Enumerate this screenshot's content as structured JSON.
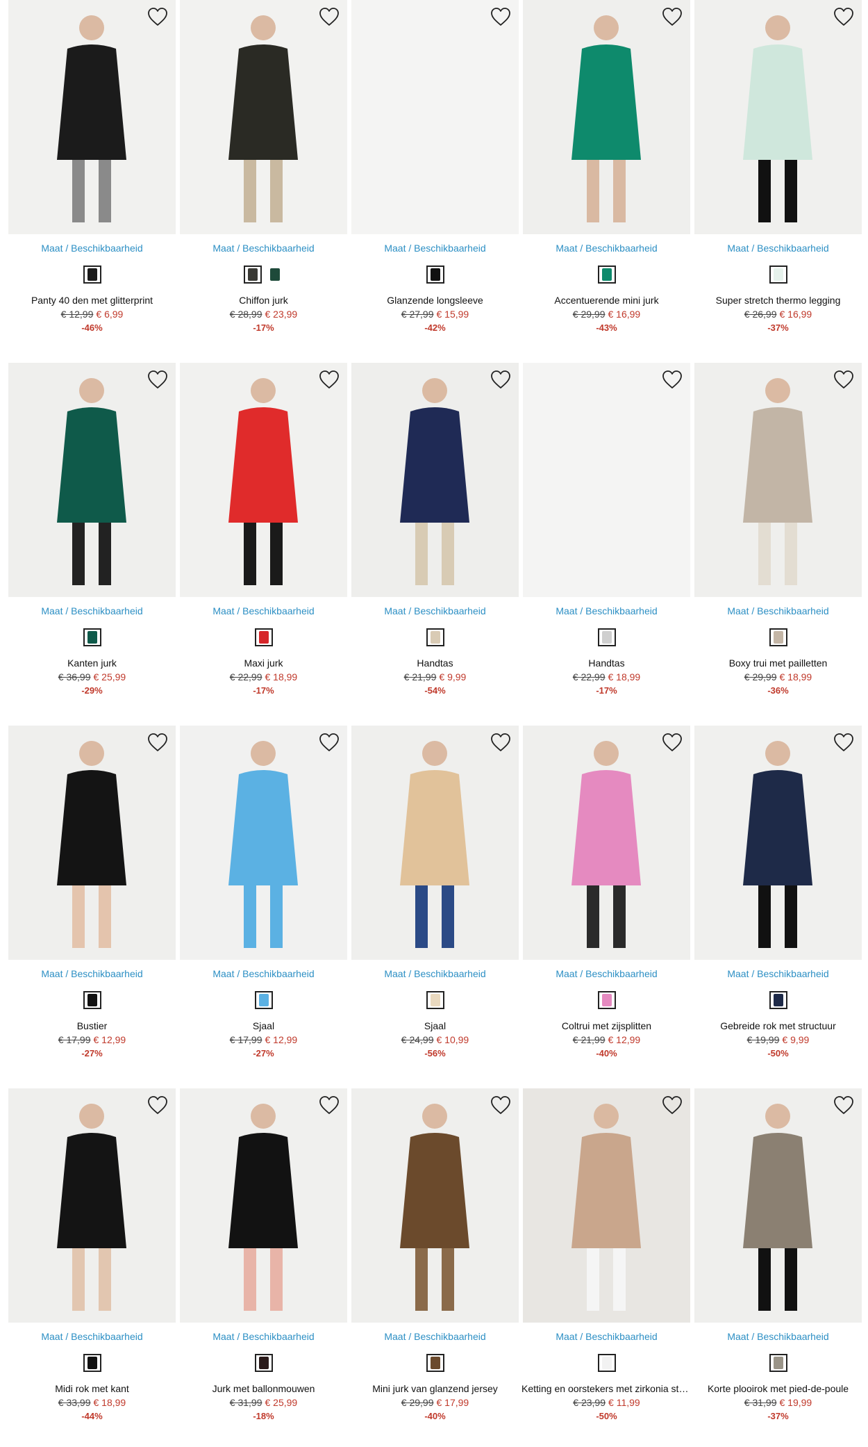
{
  "labels": {
    "size": "Maat / Beschikbaarheid"
  },
  "products": [
    {
      "name": "Panty 40 den met glitterprint",
      "old": "€ 12,99",
      "new": "€ 6,99",
      "disc": "-46%",
      "bg": "#f1f1ef",
      "fig": "#1b1b1b",
      "accent": "#8a8a8a",
      "swatches": [
        "#1a1a1a"
      ]
    },
    {
      "name": "Chiffon jurk",
      "old": "€ 28,99",
      "new": "€ 23,99",
      "disc": "-17%",
      "bg": "#f2f2f0",
      "fig": "#2a2a24",
      "accent": "#c9b9a0",
      "swatches": [
        "#3a3a35",
        "#1e4a3a"
      ]
    },
    {
      "name": "Glanzende longsleeve",
      "old": "€ 27,99",
      "new": "€ 15,99",
      "disc": "-42%",
      "bg": "#f4f4f3",
      "fig": "#f4f4f3",
      "accent": "#f4f4f3",
      "swatches": [
        "#111111"
      ]
    },
    {
      "name": "Accentuerende mini jurk",
      "old": "€ 29,99",
      "new": "€ 16,99",
      "disc": "-43%",
      "bg": "#efefed",
      "fig": "#0e8a6c",
      "accent": "#d9b9a2",
      "swatches": [
        "#0e8a6c"
      ]
    },
    {
      "name": "Super stretch thermo legging",
      "old": "€ 26,99",
      "new": "€ 16,99",
      "disc": "-37%",
      "bg": "#f0f0ee",
      "fig": "#cfe7dc",
      "accent": "#111111",
      "swatches": [
        "#e6f2ec"
      ]
    },
    {
      "name": "Kanten jurk",
      "old": "€ 36,99",
      "new": "€ 25,99",
      "disc": "-29%",
      "bg": "#efefed",
      "fig": "#0f5a4a",
      "accent": "#222222",
      "swatches": [
        "#0f5a4a"
      ]
    },
    {
      "name": "Maxi jurk",
      "old": "€ 22,99",
      "new": "€ 18,99",
      "disc": "-17%",
      "bg": "#f1f1ef",
      "fig": "#e02b2b",
      "accent": "#1a1a1a",
      "swatches": [
        "#d6262a"
      ]
    },
    {
      "name": "Handtas",
      "old": "€ 21,99",
      "new": "€ 9,99",
      "disc": "-54%",
      "bg": "#eeeeec",
      "fig": "#1f2a55",
      "accent": "#d8cbb4",
      "swatches": [
        "#d9cbb5"
      ]
    },
    {
      "name": "Handtas",
      "old": "€ 22,99",
      "new": "€ 18,99",
      "disc": "-17%",
      "bg": "#f4f4f3",
      "fig": "#f4f4f3",
      "accent": "#f4f4f3",
      "swatches": [
        "#cfcfcf"
      ]
    },
    {
      "name": "Boxy trui met pailletten",
      "old": "€ 29,99",
      "new": "€ 18,99",
      "disc": "-36%",
      "bg": "#efefed",
      "fig": "#c2b5a6",
      "accent": "#e3ddd2",
      "swatches": [
        "#c4b6a6"
      ]
    },
    {
      "name": "Bustier",
      "old": "€ 17,99",
      "new": "€ 12,99",
      "disc": "-27%",
      "bg": "#efefed",
      "fig": "#141414",
      "accent": "#e4c4ad",
      "swatches": [
        "#111111"
      ]
    },
    {
      "name": "Sjaal",
      "old": "€ 17,99",
      "new": "€ 12,99",
      "disc": "-27%",
      "bg": "#f1f1f0",
      "fig": "#5bb1e3",
      "accent": "#5bb1e3",
      "swatches": [
        "#5bb1e3"
      ]
    },
    {
      "name": "Sjaal",
      "old": "€ 24,99",
      "new": "€ 10,99",
      "disc": "-56%",
      "bg": "#efefed",
      "fig": "#e1c29a",
      "accent": "#2b4a86",
      "swatches": [
        "#e9d9bf"
      ]
    },
    {
      "name": "Coltrui met zijsplitten",
      "old": "€ 21,99",
      "new": "€ 12,99",
      "disc": "-40%",
      "bg": "#efefed",
      "fig": "#e58ac0",
      "accent": "#2a2a2a",
      "swatches": [
        "#e58ac0"
      ]
    },
    {
      "name": "Gebreide rok met structuur",
      "old": "€ 19,99",
      "new": "€ 9,99",
      "disc": "-50%",
      "bg": "#f0f0ee",
      "fig": "#1e2a48",
      "accent": "#111111",
      "swatches": [
        "#1e2a48"
      ]
    },
    {
      "name": "Midi rok met kant",
      "old": "€ 33,99",
      "new": "€ 18,99",
      "disc": "-44%",
      "bg": "#efefed",
      "fig": "#141414",
      "accent": "#e2c6b0",
      "swatches": [
        "#111111"
      ]
    },
    {
      "name": "Jurk met ballonmouwen",
      "old": "€ 31,99",
      "new": "€ 25,99",
      "disc": "-18%",
      "bg": "#f0f0ee",
      "fig": "#121212",
      "accent": "#e8b4a8",
      "swatches": [
        "#2a1a1a"
      ]
    },
    {
      "name": "Mini jurk van glanzend jersey",
      "old": "€ 29,99",
      "new": "€ 17,99",
      "disc": "-40%",
      "bg": "#efefed",
      "fig": "#6b4a2c",
      "accent": "#8a6a4a",
      "swatches": [
        "#6b4a2c"
      ]
    },
    {
      "name": "Ketting en oorstekers met zirkonia steentjes",
      "old": "€ 23,99",
      "new": "€ 11,99",
      "disc": "-50%",
      "bg": "#e8e6e2",
      "fig": "#c9a68c",
      "accent": "#f5f5f5",
      "swatches": [
        "#f2f2f2"
      ]
    },
    {
      "name": "Korte plooirok met pied-de-poule",
      "old": "€ 31,99",
      "new": "€ 19,99",
      "disc": "-37%",
      "bg": "#efefed",
      "fig": "#8b8072",
      "accent": "#111111",
      "swatches": [
        "#9a9488"
      ]
    }
  ]
}
